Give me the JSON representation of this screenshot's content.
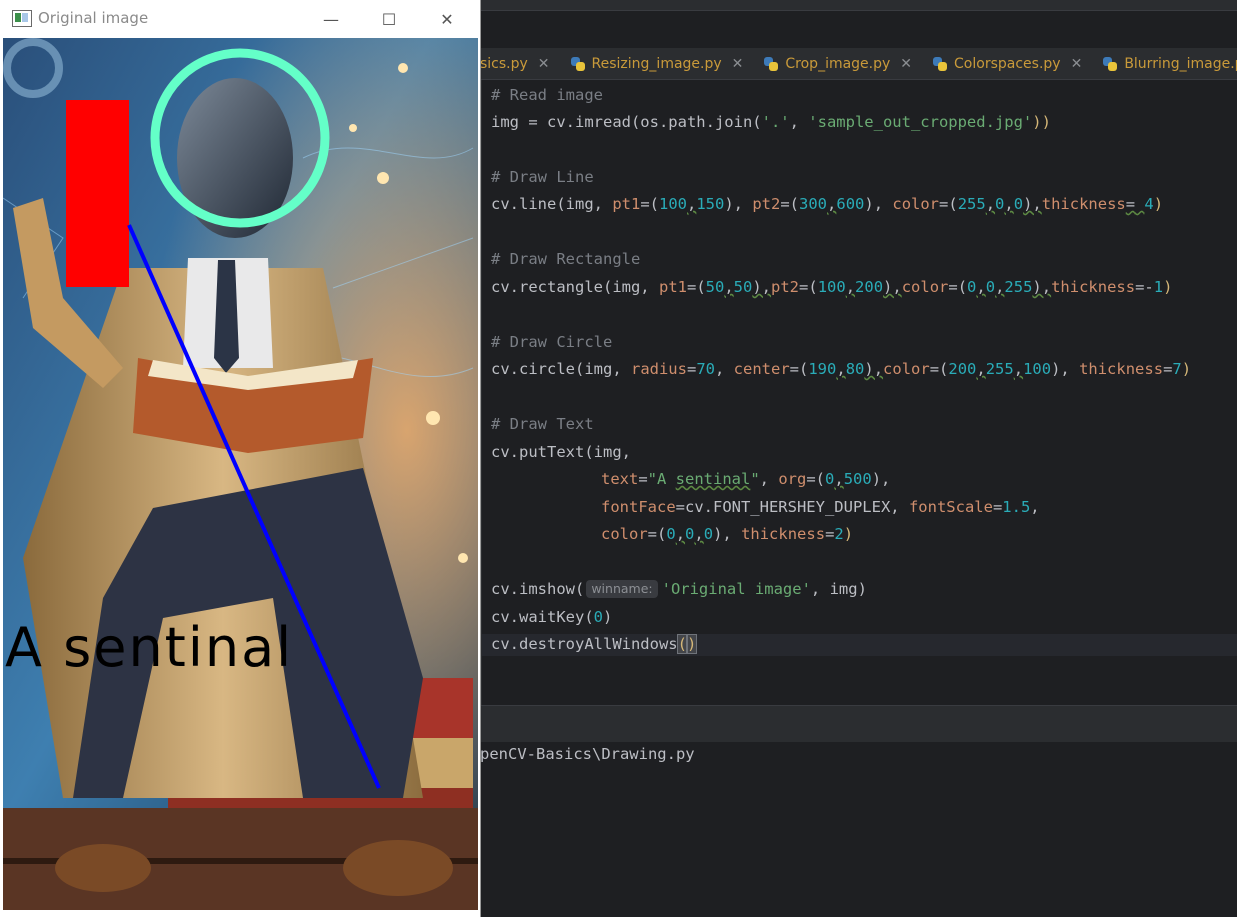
{
  "opencv_window": {
    "title": "Original image",
    "minimize_glyph": "—",
    "maximize_glyph": "☐",
    "close_glyph": "✕",
    "drawn_text": "A sentinal",
    "drawn_colors": {
      "rectangle": "#ff0000",
      "line": "#0000ff",
      "circle": "#64ffc8",
      "text": "#000000"
    }
  },
  "tabs": [
    {
      "label": "sics.py",
      "close": "✕"
    },
    {
      "label": "Resizing_image.py",
      "close": "✕"
    },
    {
      "label": "Crop_image.py",
      "close": "✕"
    },
    {
      "label": "Colorspaces.py",
      "close": "✕"
    },
    {
      "label": "Blurring_image.py",
      "close": "✕"
    }
  ],
  "code": {
    "l1": "# Read image",
    "l2a": "img = cv.imread(os.path.join(",
    "l2b": "'.'",
    "l2c": ", ",
    "l2d": "'sample_out_cropped.jpg'",
    "l2e": "))",
    "l3": "# Draw Line",
    "l4a": "cv.line(img, ",
    "l4b": "pt1",
    "l4c": "=(",
    "l4d": "100",
    "l4e": ",",
    "l4f": "150",
    "l4g": "), ",
    "l4h": "pt2",
    "l4i": "=(",
    "l4j": "300",
    "l4k": ",",
    "l4l": "600",
    "l4m": "), ",
    "l4n": "color",
    "l4o": "=(",
    "l4p": "255",
    "l4q": ",",
    "l4r": "0",
    "l4s": ",",
    "l4t": "0",
    "l4u": "),",
    "l4v": "thickness",
    "l4w": "= ",
    "l4x": "4",
    "l4y": ")",
    "l5": "# Draw Rectangle",
    "l6a": "cv.rectangle(img, ",
    "l6b": "pt1",
    "l6c": "=(",
    "l6d": "50",
    "l6e": ",",
    "l6f": "50",
    "l6g": "),",
    "l6h": "pt2",
    "l6i": "=(",
    "l6j": "100",
    "l6k": ",",
    "l6l": "200",
    "l6m": "),",
    "l6n": "color",
    "l6o": "=(",
    "l6p": "0",
    "l6q": ",",
    "l6r": "0",
    "l6s": ",",
    "l6t": "255",
    "l6u": "),",
    "l6v": "thickness",
    "l6w": "=-",
    "l6x": "1",
    "l6y": ")",
    "l7": "# Draw Circle",
    "l8a": "cv.circle(img, ",
    "l8b": "radius",
    "l8c": "=",
    "l8d": "70",
    "l8e": ", ",
    "l8f": "center",
    "l8g": "=(",
    "l8h": "190",
    "l8i": ",",
    "l8j": "80",
    "l8k": "),",
    "l8l": "color",
    "l8m": "=(",
    "l8n": "200",
    "l8o": ",",
    "l8p": "255",
    "l8q": ",",
    "l8r": "100",
    "l8s": "), ",
    "l8t": "thickness",
    "l8u": "=",
    "l8v": "7",
    "l8w": ")",
    "l9": "# Draw Text",
    "l10": "cv.putText(img,",
    "l11a": "text",
    "l11b": "=",
    "l11c": "\"A ",
    "l11d": "sentinal",
    "l11e": "\"",
    "l11f": ", ",
    "l11g": "org",
    "l11h": "=(",
    "l11i": "0",
    "l11j": ",",
    "l11k": "500",
    "l11l": "),",
    "l12a": "fontFace",
    "l12b": "=cv.FONT_HERSHEY_DUPLEX, ",
    "l12c": "fontScale",
    "l12d": "=",
    "l12e": "1.5",
    "l12f": ",",
    "l13a": "color",
    "l13b": "=(",
    "l13c": "0",
    "l13d": ",",
    "l13e": "0",
    "l13f": ",",
    "l13g": "0",
    "l13h": "), ",
    "l13i": "thickness",
    "l13j": "=",
    "l13k": "2",
    "l13l": ")",
    "l14a": "cv.imshow(",
    "l14hint": "winname:",
    "l14b": "'Original image'",
    "l14c": ", img)",
    "l15a": "cv.waitKey(",
    "l15b": "0",
    "l15c": ")",
    "l16a": "cv.destroyAllWindows",
    "l16b": "(",
    "l16c": ")"
  },
  "run_output": {
    "line": "penCV-Basics\\Drawing.py"
  }
}
